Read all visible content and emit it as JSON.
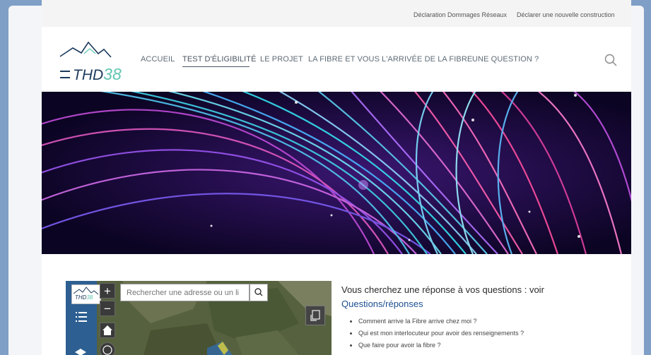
{
  "topbar": {
    "links": [
      "Déclaration Dommages Réseaux",
      "Déclarer une nouvelle construction"
    ]
  },
  "logo": {
    "brand": "THD",
    "number": "38"
  },
  "nav": {
    "items": [
      "ACCUEIL",
      "TEST D'ÉLIGIBILITÉ",
      "LE PROJET",
      "LA FIBRE ET VOUS",
      "L'ARRIVÉE DE LA FIBRE",
      "UNE QUESTION ?"
    ],
    "active_index": 1
  },
  "map": {
    "mini_logo": {
      "brand": "THD",
      "number": "38"
    },
    "zoom_in": "+",
    "zoom_out": "−",
    "search_placeholder": "Rechercher une adresse ou un li"
  },
  "faq": {
    "heading": "Vous cherchez une réponse à vos questions : voir",
    "link": "Questions/réponses",
    "items": [
      "Comment arrive la Fibre arrive chez moi ?",
      "Qui est mon interlocuteur pour avoir des renseignements ?",
      "Que faire pour avoir la fibre ?"
    ]
  },
  "colors": {
    "accent": "#5ec6b0",
    "brand_dark": "#1c3a5d",
    "link": "#1d4f91",
    "map_sidebar": "#2d5f92",
    "hero_bg": "#0c0526"
  },
  "icons": [
    "search-icon",
    "list-icon",
    "home-icon",
    "locate-icon",
    "layers-icon",
    "basemap-icon"
  ]
}
